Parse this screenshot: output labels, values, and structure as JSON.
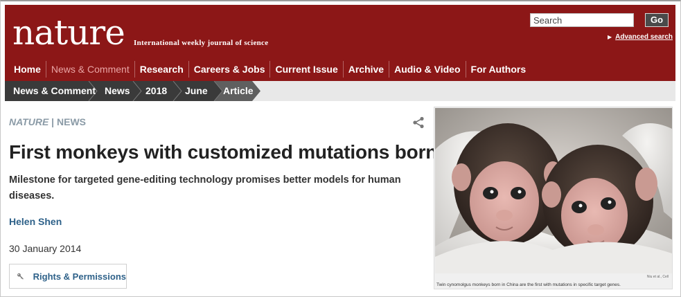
{
  "header": {
    "logo": "nature",
    "tagline": "International weekly journal of science",
    "search": {
      "placeholder": "Search",
      "button": "Go"
    },
    "advanced_search": "Advanced search",
    "nav": [
      "Home",
      "News & Comment",
      "Research",
      "Careers & Jobs",
      "Current Issue",
      "Archive",
      "Audio & Video",
      "For Authors"
    ],
    "active_nav": "News & Comment"
  },
  "breadcrumb": [
    "News & Comment",
    "News",
    "2018",
    "June",
    "Article"
  ],
  "article": {
    "journal": "NATURE",
    "section": "NEWS",
    "title": "First monkeys with customized mutations born",
    "standfirst": "Milestone for targeted gene-editing technology promises better models for human diseases.",
    "author": "Helen Shen",
    "date": "30 January 2014",
    "rights_label": "Rights & Permissions"
  },
  "figure": {
    "credit": "Niu et al., Cell",
    "caption": "Twin cynomolgus monkeys born in China are the first with mutations in specific target genes."
  },
  "colors": {
    "brand": "#8c1717",
    "crumb_dark": "#3a3a3a",
    "link": "#2e6189",
    "kicker": "#8a9aa6"
  },
  "icons": [
    "share-icon",
    "key-icon"
  ]
}
